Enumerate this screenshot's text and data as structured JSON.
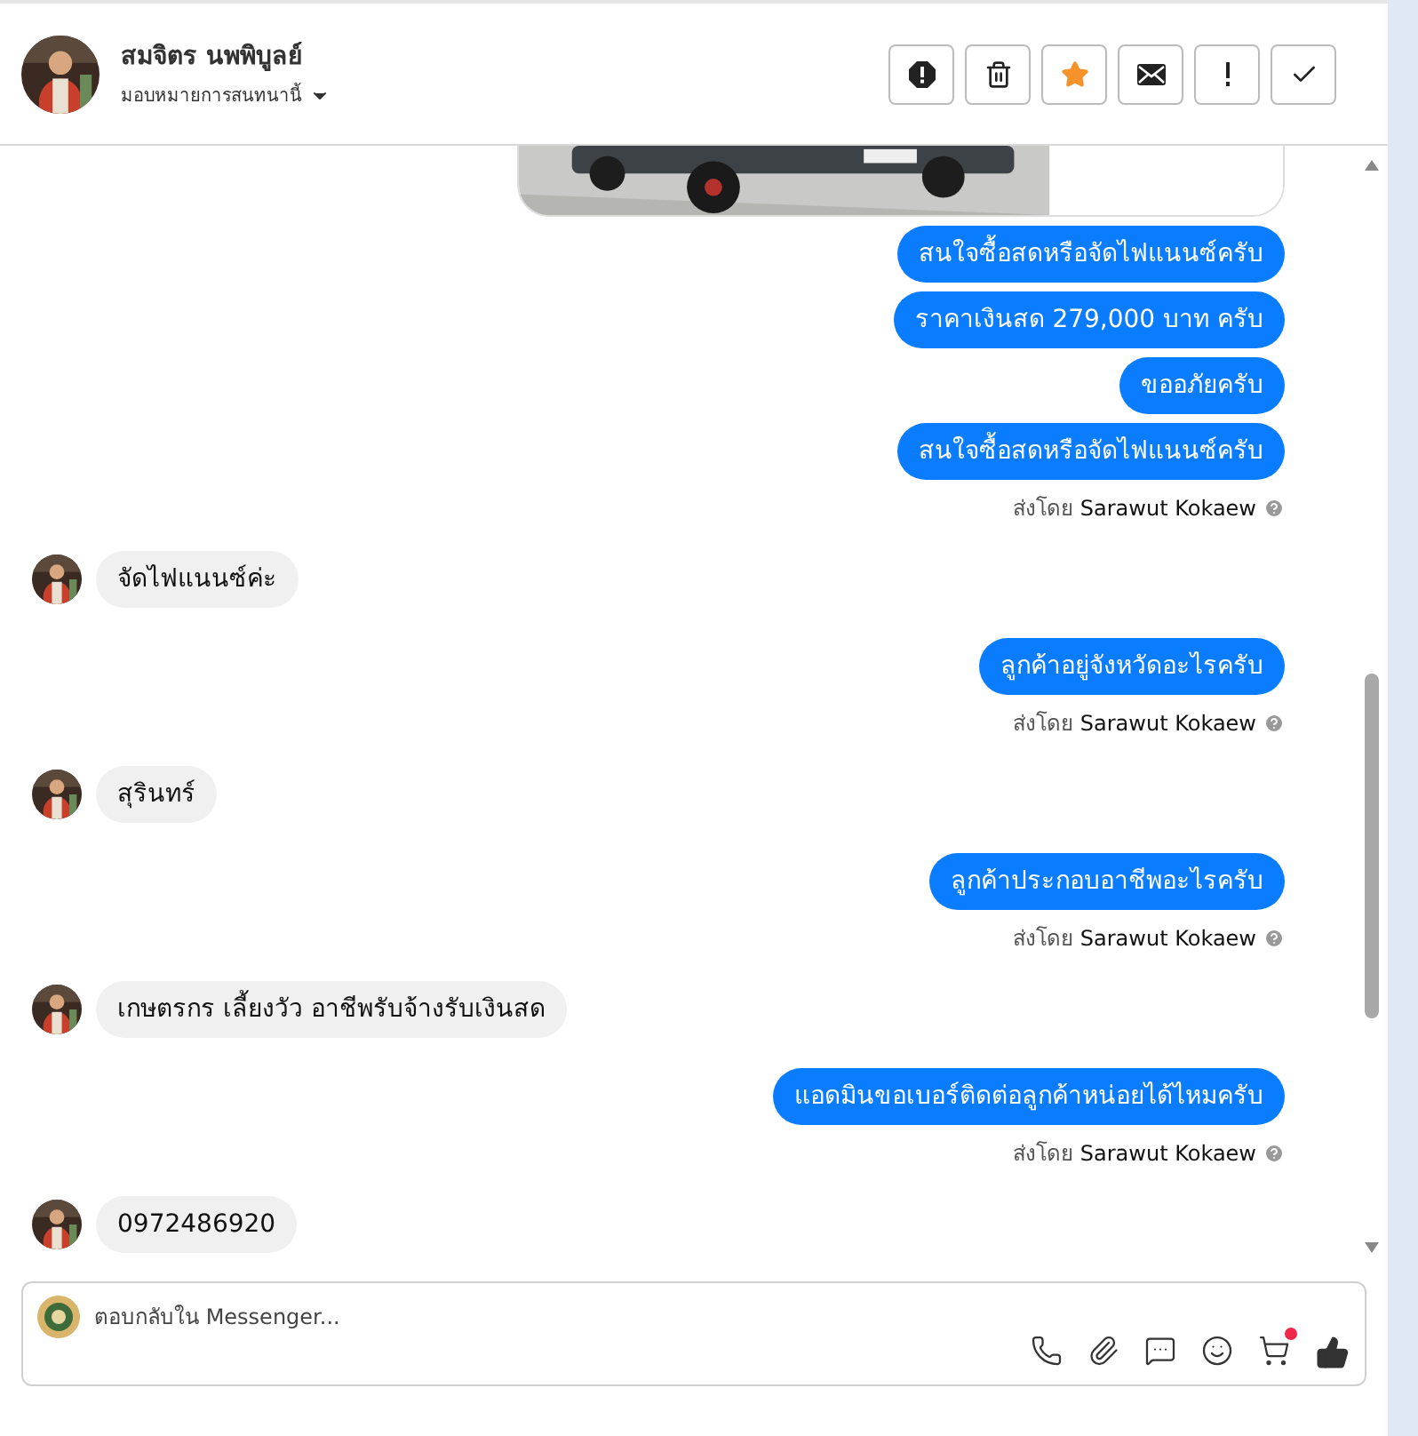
{
  "header": {
    "name": "สมจิตร นพพิบูลย์",
    "assign_label": "มอบหมายการสนทนานี้",
    "starred": true,
    "actions": [
      {
        "kind": "spam"
      },
      {
        "kind": "trash"
      },
      {
        "kind": "star"
      },
      {
        "kind": "mail"
      },
      {
        "kind": "important"
      },
      {
        "kind": "done"
      }
    ]
  },
  "messages": [
    {
      "kind": "picture"
    },
    {
      "kind": "out",
      "text": "สนใจซื้อสดหรือจัดไฟแนนซ์ครับ"
    },
    {
      "kind": "out",
      "text": "ราคาเงินสด 279,000 บาท ครับ"
    },
    {
      "kind": "out",
      "text": "ขออภัยครับ"
    },
    {
      "kind": "out",
      "text": "สนใจซื้อสดหรือจัดไฟแนนซ์ครับ"
    },
    {
      "kind": "note",
      "prefix": "ส่งโดย",
      "name": "Sarawut Kokaew"
    },
    {
      "kind": "in",
      "text": "จัดไฟแนนซ์ค่ะ"
    },
    {
      "kind": "out",
      "text": "ลูกค้าอยู่จังหวัดอะไรครับ"
    },
    {
      "kind": "note",
      "prefix": "ส่งโดย",
      "name": "Sarawut Kokaew"
    },
    {
      "kind": "in",
      "text": "สุรินทร์"
    },
    {
      "kind": "out",
      "text": "ลูกค้าประกอบอาชีพอะไรครับ"
    },
    {
      "kind": "note",
      "prefix": "ส่งโดย",
      "name": "Sarawut Kokaew"
    },
    {
      "kind": "in",
      "text": "เกษตรกร เลี้ยงวัว อาชีพรับจ้างรับเงินสด"
    },
    {
      "kind": "out",
      "text": "แอดมินขอเบอร์ติดต่อลูกค้าหน่อยได้ไหมครับ"
    },
    {
      "kind": "note",
      "prefix": "ส่งโดย",
      "name": "Sarawut Kokaew"
    },
    {
      "kind": "in",
      "text": "0972486920"
    }
  ],
  "composer": {
    "placeholder": "ตอบกลับใน Messenger...",
    "cart_badge": true
  }
}
